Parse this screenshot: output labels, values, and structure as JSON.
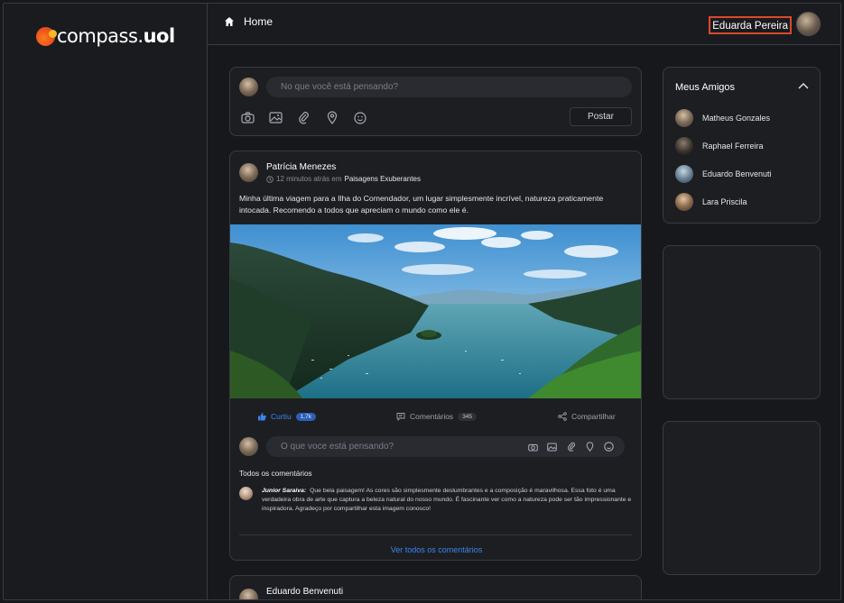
{
  "brand": {
    "logo_text_left": "compass.",
    "logo_text_right": "uol"
  },
  "topbar": {
    "home_label": "Home",
    "user_name": "Eduarda Pereira"
  },
  "new_post": {
    "placeholder": "No que você está pensando?",
    "post_button": "Postar"
  },
  "post": {
    "author": "Patrícia Menezes",
    "time": "12 minutos atrás em",
    "group": "Paisagens Exuberantes",
    "text": "Minha última viagem para a Ilha do Comendador, um lugar simplesmente incrível, natureza praticamente intocada. Recomendo a todos que apreciam o mundo como ele é.",
    "like_label": "Curtiu",
    "like_count": "1.7k",
    "comments_label": "Comentários",
    "comments_count": "345",
    "share_label": "Compartilhar",
    "comment_placeholder": "O que voce está pensando?",
    "all_comments_label": "Todos os comentários",
    "comment_author": "Junior Saraiva:",
    "comment_text": "Que bela paisagem! As cores são simplesmente deslumbrantes e a composição é maravilhosa. Essa foto é uma verdadeira obra de arte que captura a beleza natural do nosso mundo. É fascinante ver como a natureza pode ser tão impressionante e inspiradora. Agradeço por compartilhar esta imagem conosco!",
    "view_all": "Ver todos os comentários"
  },
  "next_post": {
    "author": "Eduardo Benvenuti"
  },
  "friends": {
    "title": "Meus Amigos",
    "items": [
      {
        "name": "Matheus Gonzales"
      },
      {
        "name": "Raphael Ferreira"
      },
      {
        "name": "Eduardo Benvenuti"
      },
      {
        "name": "Lara Priscila"
      }
    ]
  },
  "colors": {
    "accent": "#3a86f0",
    "highlight_border": "#d9492f",
    "background": "#17181c",
    "card": "#1d1e22"
  }
}
